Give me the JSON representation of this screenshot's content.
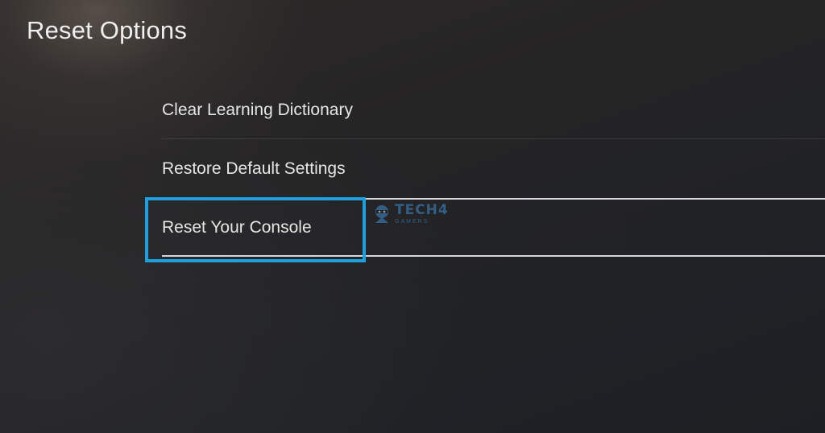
{
  "header": {
    "title": "Reset Options"
  },
  "menu": {
    "items": [
      {
        "label": "Clear Learning Dictionary",
        "selected": false
      },
      {
        "label": "Restore Default Settings",
        "selected": false
      },
      {
        "label": "Reset Your Console",
        "selected": true
      }
    ]
  },
  "watermark": {
    "text": "TECH4",
    "subtext": "GAMERS",
    "color": "#3f8fd6"
  },
  "colors": {
    "highlight_border": "#1ea0df",
    "text": "#e6e6e6"
  }
}
